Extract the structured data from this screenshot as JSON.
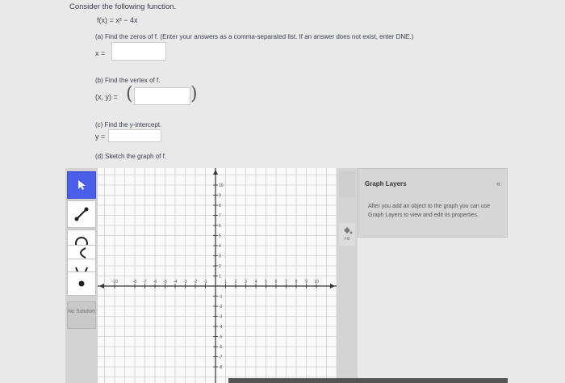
{
  "question": {
    "intro": "Consider the following function.",
    "function": "f(x) = x² − 4x"
  },
  "parts": {
    "a": {
      "prompt": "(a) Find the zeros of f. (Enter your answers as a comma-separated list. If an answer does not exist, enter DNE.)",
      "label": "x =",
      "value": ""
    },
    "b": {
      "prompt": "(b) Find the vertex of f.",
      "label": "(x, y) =",
      "value": ""
    },
    "c": {
      "prompt": "(c) Find the y-intercept.",
      "label": "y =",
      "value": ""
    },
    "d": {
      "prompt": "(d) Sketch the graph of f."
    }
  },
  "toolbar": {
    "tools": [
      {
        "name": "select-tool",
        "icon": "arrow-cursor-icon",
        "active": true
      },
      {
        "name": "line-tool",
        "icon": "line-segment-icon",
        "active": false
      },
      {
        "name": "circle-tool",
        "icon": "circle-icon",
        "active": false
      },
      {
        "name": "parabola-sideways-tool",
        "icon": "parabola-left-icon",
        "active": false
      },
      {
        "name": "parabola-tool",
        "icon": "parabola-up-icon",
        "active": false
      },
      {
        "name": "point-tool",
        "icon": "point-icon",
        "active": false
      }
    ],
    "no_solution_label": "No Solution"
  },
  "graph": {
    "x_range": [
      -10,
      10
    ],
    "y_range": [
      -10,
      10
    ],
    "x_tick_labels": [
      "-10",
      "-8",
      "-7",
      "-6",
      "-5",
      "-4",
      "-3",
      "-2",
      "-1",
      "1",
      "2",
      "3",
      "4",
      "5",
      "6",
      "7",
      "8",
      "9",
      "10"
    ],
    "y_tick_labels": [
      "10",
      "9",
      "8",
      "7",
      "6",
      "5",
      "4",
      "3",
      "2",
      "1",
      "-1",
      "-2",
      "-3",
      "-4",
      "-5",
      "-6",
      "-7",
      "-8"
    ]
  },
  "fill_button": {
    "label": "Fill",
    "icon": "fill-bucket-icon"
  },
  "graph_layers": {
    "title": "Graph Layers",
    "collapse_icon": "double-chevron-left-icon",
    "collapse_glyph": "«",
    "description": "After you add an object to the graph you can use Graph Layers to view and edit its properties."
  },
  "colors": {
    "accent": "#4a5eea",
    "panel_bg": "#d6d6d6",
    "page_bg": "#e9e9e9"
  }
}
